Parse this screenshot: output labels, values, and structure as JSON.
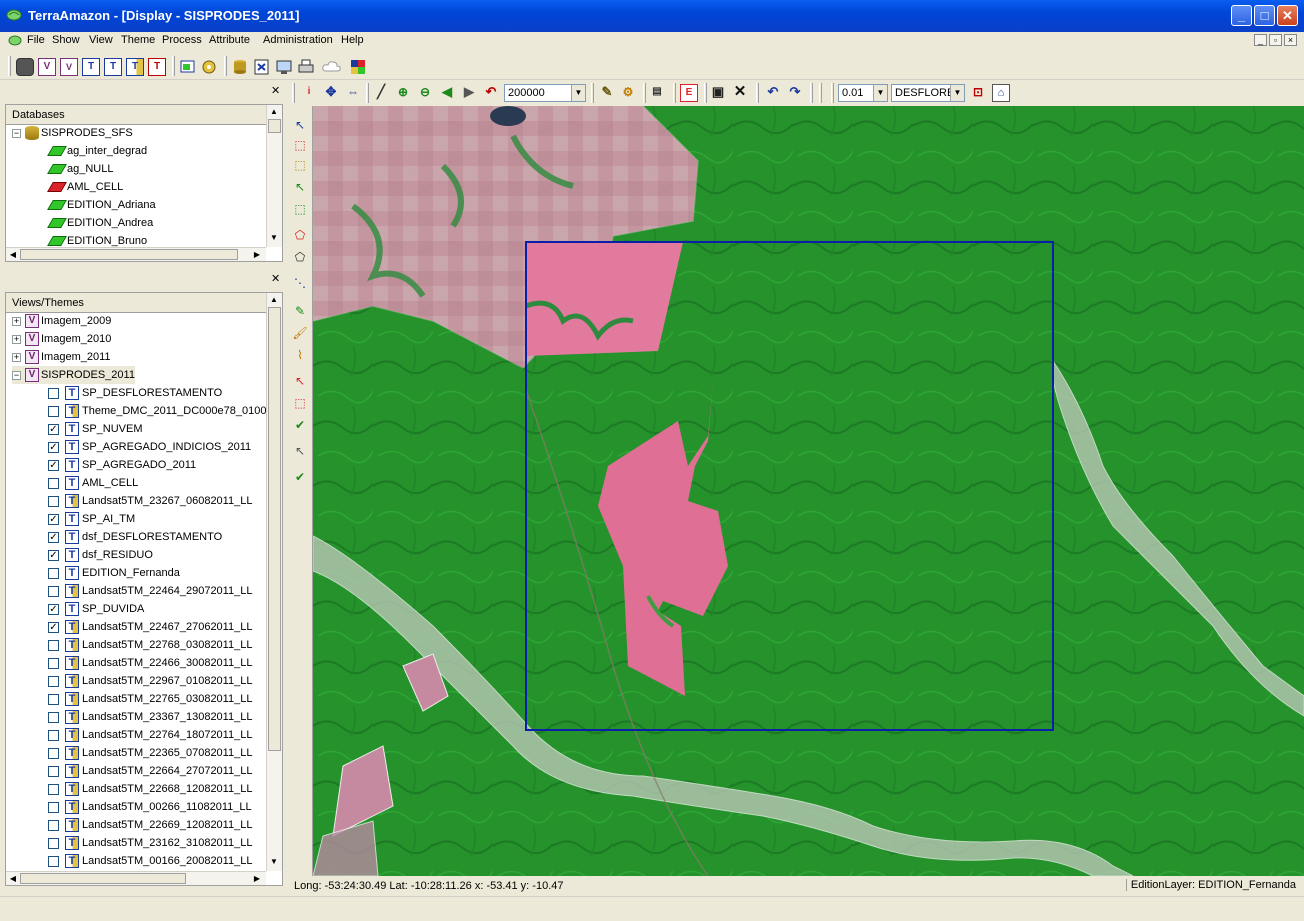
{
  "window": {
    "title": "TerraAmazon - [Display - SISPRODES_2011]",
    "buttons": {
      "minimize": "_",
      "maximize": "□",
      "close": "✕"
    }
  },
  "menu": {
    "items": [
      "File",
      "Show",
      "View",
      "Theme",
      "Process",
      "Attribute",
      "Administration",
      "Help"
    ]
  },
  "toolbar": {
    "row1_icons": [
      "stop-icon",
      "v-icon",
      "vp-icon",
      "t-icon",
      "t-plus-icon",
      "t-yellow-icon",
      "t-red-icon",
      "display-icon",
      "gear-icon",
      "database-icon",
      "query-icon",
      "monitor-icon",
      "print-icon",
      "cloud-icon",
      "layers-icon"
    ],
    "row1_letters": [
      "V",
      "V",
      "T",
      "T",
      "T",
      "T"
    ],
    "scale_value": "200000",
    "tolerance_value": "0.01",
    "layer_value": "DESFLORE",
    "edit_label": "E"
  },
  "databases": {
    "caption": "Databases",
    "root": "SISPRODES_SFS",
    "items": [
      {
        "label": "ag_inter_degrad",
        "icon": "polygon-layer-icon"
      },
      {
        "label": "ag_NULL",
        "icon": "polygon-layer-icon"
      },
      {
        "label": "AML_CELL",
        "icon": "cell-layer-icon"
      },
      {
        "label": "EDITION_Adriana",
        "icon": "polygon-layer-icon"
      },
      {
        "label": "EDITION_Andrea",
        "icon": "polygon-layer-icon"
      },
      {
        "label": "EDITION_Bruno",
        "icon": "polygon-layer-icon"
      }
    ]
  },
  "views": {
    "caption": "Views/Themes",
    "views": [
      "Imagem_2009",
      "Imagem_2010",
      "Imagem_2011",
      "SISPRODES_2011"
    ],
    "themes": [
      {
        "label": "SP_DESFLORESTAMENTO",
        "checked": false,
        "raster": false
      },
      {
        "label": "Theme_DMC_2011_DC000e78_0100",
        "checked": false,
        "raster": true
      },
      {
        "label": "SP_NUVEM",
        "checked": true,
        "raster": false
      },
      {
        "label": "SP_AGREGADO_INDICIOS_2011",
        "checked": true,
        "raster": false
      },
      {
        "label": "SP_AGREGADO_2011",
        "checked": true,
        "raster": false
      },
      {
        "label": "AML_CELL",
        "checked": false,
        "raster": false
      },
      {
        "label": "Landsat5TM_23267_06082011_LL",
        "checked": false,
        "raster": true
      },
      {
        "label": "SP_AI_TM",
        "checked": true,
        "raster": false
      },
      {
        "label": "dsf_DESFLORESTAMENTO",
        "checked": true,
        "raster": false
      },
      {
        "label": "dsf_RESIDUO",
        "checked": true,
        "raster": false
      },
      {
        "label": "EDITION_Fernanda",
        "checked": false,
        "raster": false
      },
      {
        "label": "Landsat5TM_22464_29072011_LL",
        "checked": false,
        "raster": true
      },
      {
        "label": "SP_DUVIDA",
        "checked": true,
        "raster": false
      },
      {
        "label": "Landsat5TM_22467_27062011_LL",
        "checked": true,
        "raster": true
      },
      {
        "label": "Landsat5TM_22768_03082011_LL",
        "checked": false,
        "raster": true
      },
      {
        "label": "Landsat5TM_22466_30082011_LL",
        "checked": false,
        "raster": true
      },
      {
        "label": "Landsat5TM_22967_01082011_LL",
        "checked": false,
        "raster": true
      },
      {
        "label": "Landsat5TM_22765_03082011_LL",
        "checked": false,
        "raster": true
      },
      {
        "label": "Landsat5TM_23367_13082011_LL",
        "checked": false,
        "raster": true
      },
      {
        "label": "Landsat5TM_22764_18072011_LL",
        "checked": false,
        "raster": true
      },
      {
        "label": "Landsat5TM_22365_07082011_LL",
        "checked": false,
        "raster": true
      },
      {
        "label": "Landsat5TM_22664_27072011_LL",
        "checked": false,
        "raster": true
      },
      {
        "label": "Landsat5TM_22668_12082011_LL",
        "checked": false,
        "raster": true
      },
      {
        "label": "Landsat5TM_00266_11082011_LL",
        "checked": false,
        "raster": true
      },
      {
        "label": "Landsat5TM_22669_12082011_LL",
        "checked": false,
        "raster": true
      },
      {
        "label": "Landsat5TM_23162_31082011_LL",
        "checked": false,
        "raster": true
      },
      {
        "label": "Landsat5TM_00166_20082011_LL",
        "checked": false,
        "raster": true
      }
    ]
  },
  "status": {
    "coords": "Long: -53:24:30.49  Lat: -10:28:11.26  x: -53.41  y: -10.47",
    "edit_layer": "EditionLayer: EDITION_Fernanda"
  },
  "colors": {
    "forest": "#25922c",
    "deforested": "#d9577c",
    "selection_box": "#0a1fa8",
    "cloud_mask": "#b8c7b4"
  }
}
